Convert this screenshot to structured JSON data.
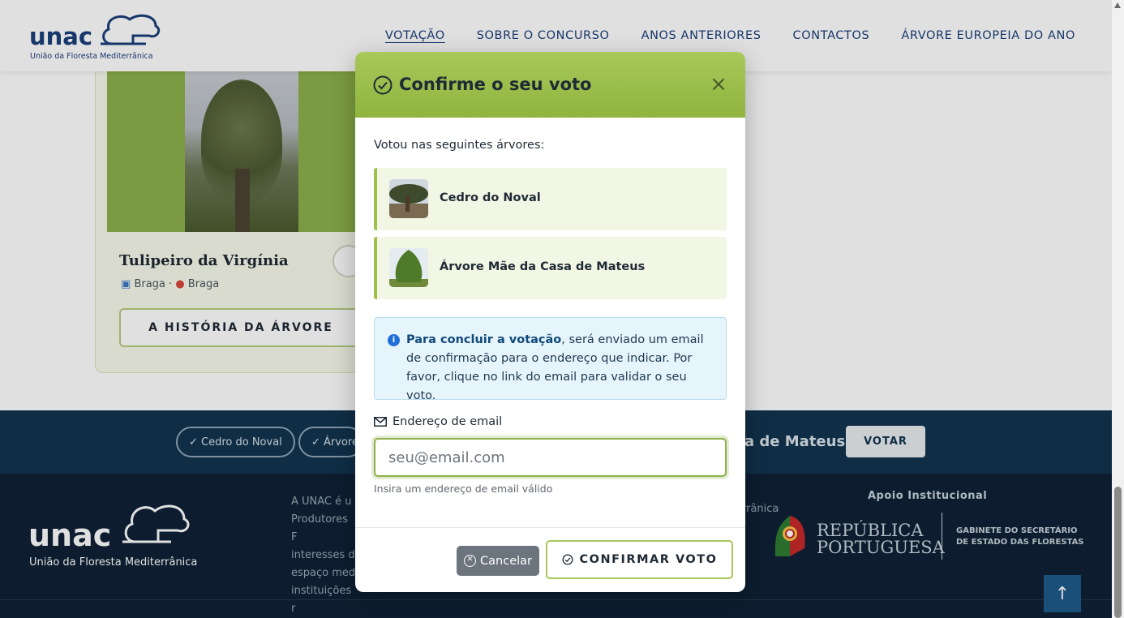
{
  "header": {
    "logo_word": "unac",
    "logo_sub": "União da Floresta Mediterrânica",
    "nav": [
      {
        "label": "VOTAÇÃO",
        "active": true
      },
      {
        "label": "SOBRE O CONCURSO",
        "active": false
      },
      {
        "label": "ANOS ANTERIORES",
        "active": false
      },
      {
        "label": "CONTACTOS",
        "active": false
      },
      {
        "label": "ÁRVORE EUROPEIA DO ANO",
        "active": false
      }
    ]
  },
  "card": {
    "title": "Tulipeiro da Virgínia",
    "region": "Braga",
    "city": "Braga",
    "history_button": "A HISTÓRIA DA ÁRVORE"
  },
  "vote_bar": {
    "chips": [
      "✓ Cedro do Noval",
      "✓ Árvore"
    ],
    "partial_text": "a de Mateus",
    "vote_button": "VOTAR"
  },
  "footer": {
    "logo_word": "unac",
    "logo_sub": "União da Floresta Mediterrânica",
    "about_lines": [
      "A UNAC é u",
      "Produtores F",
      "interesses d",
      "espaço med",
      "instituições r"
    ],
    "partial_text": "rrânica",
    "apoio_label": "Apoio Institucional",
    "republica": [
      "REPÚBLICA",
      "PORTUGUESA"
    ],
    "gabinete": [
      "GABINETE DO SECRETÁRIO",
      "DE ESTADO DAS FLORESTAS"
    ],
    "to_top": "↑"
  },
  "modal": {
    "title": "Confirme o seu voto",
    "close": "×",
    "voted_label": "Votou nas seguintes árvores:",
    "trees": [
      {
        "name": "Cedro do Noval"
      },
      {
        "name": "Árvore Mãe da Casa de Mateus"
      }
    ],
    "info_bold": "Para concluir a votação",
    "info_rest": ", será enviado um email de confirmação para o endereço que indicar. Por favor, clique no link do email para validar o seu voto.",
    "email_label": "Endereço de email",
    "email_placeholder": "seu@email.com",
    "email_value": "",
    "email_hint": "Insira um endereço de email válido",
    "cancel_label": "Cancelar",
    "confirm_label": "CONFIRMAR VOTO"
  },
  "colors": {
    "brand_blue": "#1b3f7a",
    "brand_green": "#9fc04c",
    "dark_navy": "#12344f",
    "info_blue": "#1e6fd9"
  }
}
